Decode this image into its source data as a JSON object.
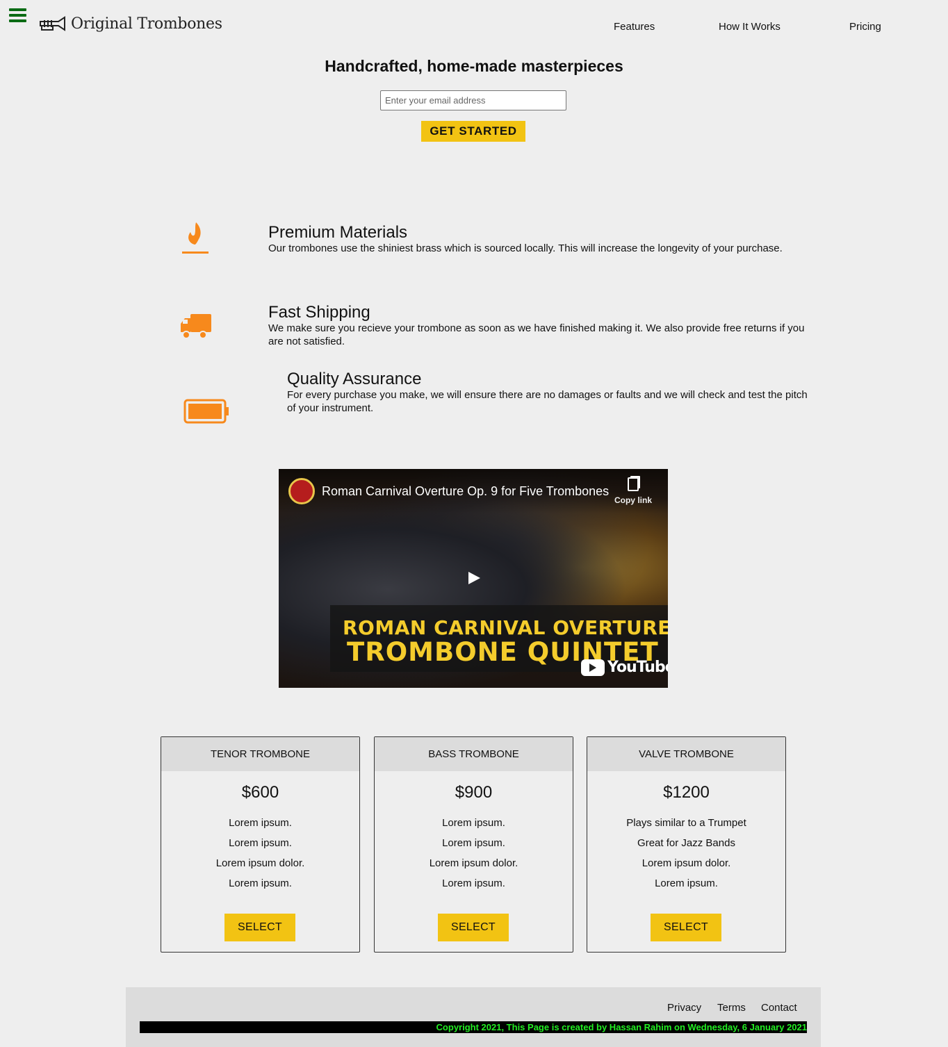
{
  "header": {
    "logo_text": "Original Trombones",
    "nav": [
      "Features",
      "How It Works",
      "Pricing"
    ]
  },
  "hero": {
    "title": "Handcrafted, home-made masterpieces",
    "email_placeholder": "Enter your email address",
    "cta_label": "GET STARTED"
  },
  "features": [
    {
      "icon": "flame-icon",
      "title": "Premium Materials",
      "text": "Our trombones use the shiniest brass which is sourced locally. This will increase the longevity of your purchase."
    },
    {
      "icon": "truck-icon",
      "title": "Fast Shipping",
      "text": "We make sure you recieve your trombone as soon as we have finished making it. We also provide free returns if you are not satisfied."
    },
    {
      "icon": "battery-icon",
      "title": "Quality Assurance",
      "text": "For every purchase you make, we will ensure there are no damages or faults and we will check and test the pitch of your instrument."
    }
  ],
  "video": {
    "title": "Roman Carnival Overture Op. 9 for Five Trombones",
    "copy_link": "Copy link",
    "banner_line1": "ROMAN CARNIVAL OVERTURE",
    "banner_line2": "TROMBONE QUINTET",
    "platform": "YouTube"
  },
  "pricing": [
    {
      "name": "TENOR TROMBONE",
      "price": "$600",
      "features": [
        "Lorem ipsum.",
        "Lorem ipsum.",
        "Lorem ipsum dolor.",
        "Lorem ipsum."
      ],
      "button": "SELECT"
    },
    {
      "name": "BASS TROMBONE",
      "price": "$900",
      "features": [
        "Lorem ipsum.",
        "Lorem ipsum.",
        "Lorem ipsum dolor.",
        "Lorem ipsum."
      ],
      "button": "SELECT"
    },
    {
      "name": "VALVE TROMBONE",
      "price": "$1200",
      "features": [
        "Plays similar to a Trumpet",
        "Great for Jazz Bands",
        "Lorem ipsum dolor.",
        "Lorem ipsum."
      ],
      "button": "SELECT"
    }
  ],
  "footer": {
    "links": [
      "Privacy",
      "Terms",
      "Contact"
    ],
    "copyright": "Copyright 2021, This Page is created by Hassan Rahim on Wednesday, 6 January 2021"
  },
  "colors": {
    "accent_yellow": "#f2c313",
    "icon_orange": "#f7891c",
    "hamburger_green": "#0a6b14",
    "copyright_green": "#22ee22"
  }
}
